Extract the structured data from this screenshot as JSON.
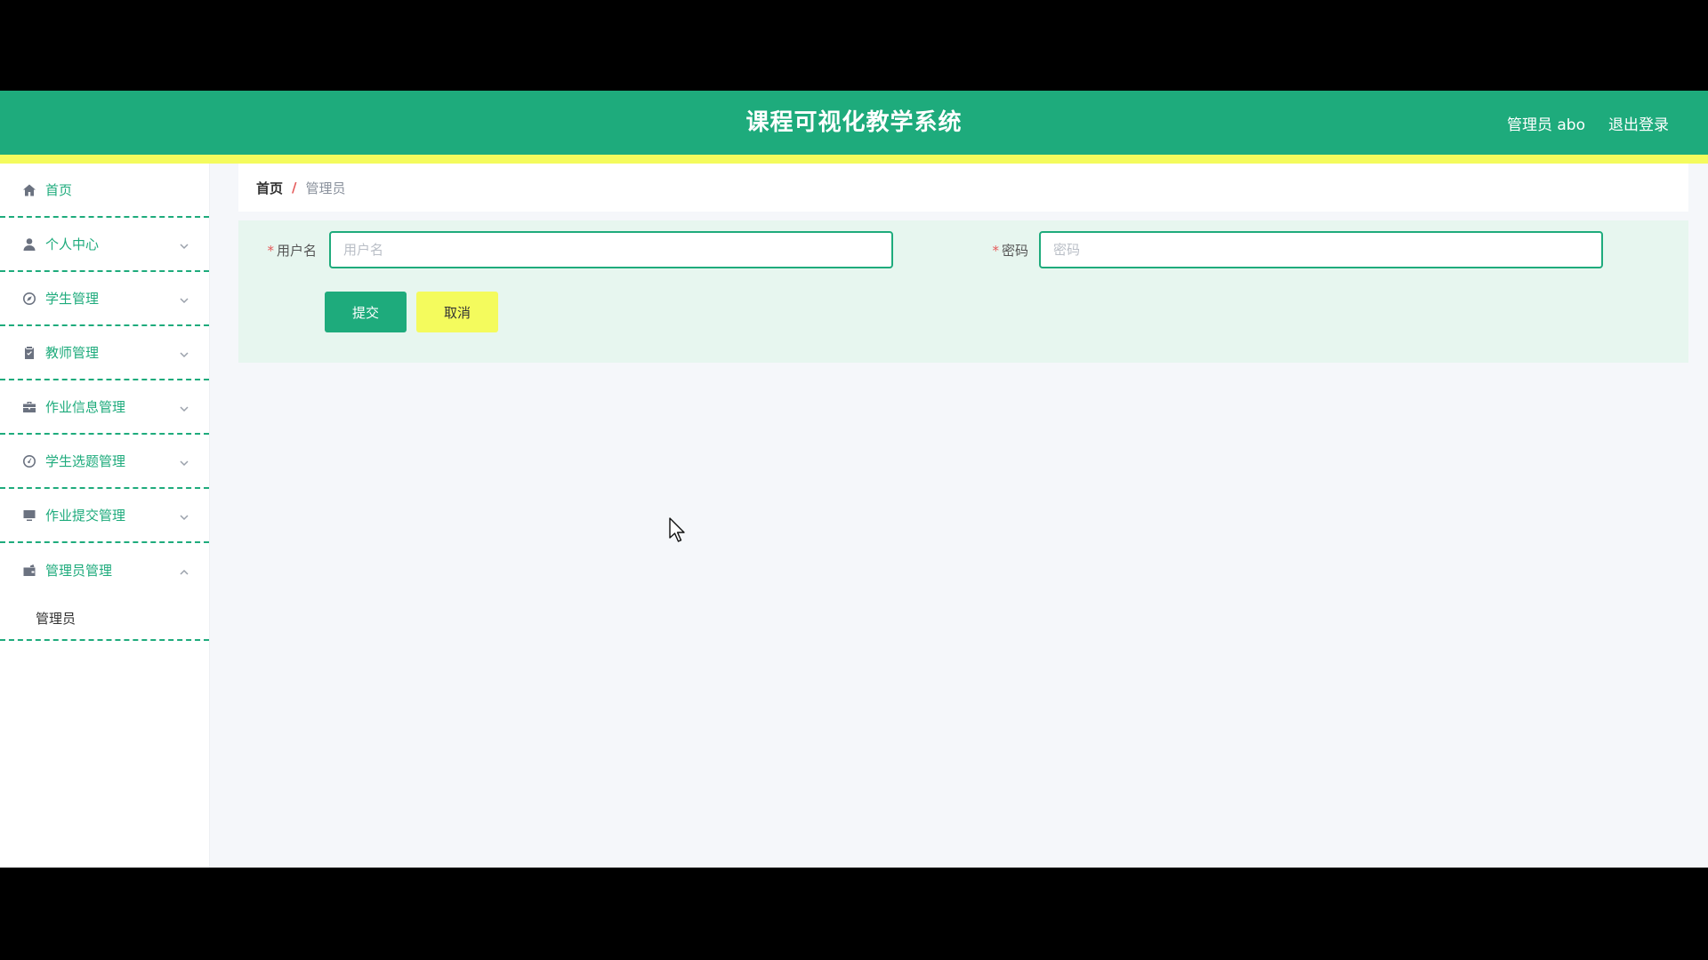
{
  "header": {
    "title": "课程可视化教学系统",
    "user": "管理员 abo",
    "logout": "退出登录",
    "colors": {
      "primary": "#1eab7c",
      "stripe": "#f4fb5d"
    }
  },
  "sidebar": {
    "items": [
      {
        "label": "首页",
        "icon": "home-icon",
        "has_arrow": false
      },
      {
        "label": "个人中心",
        "icon": "user-icon",
        "has_arrow": true
      },
      {
        "label": "学生管理",
        "icon": "compass-icon",
        "has_arrow": true
      },
      {
        "label": "教师管理",
        "icon": "clipboard-icon",
        "has_arrow": true
      },
      {
        "label": "作业信息管理",
        "icon": "briefcase-icon",
        "has_arrow": true
      },
      {
        "label": "学生选题管理",
        "icon": "gauge-icon",
        "has_arrow": true
      },
      {
        "label": "作业提交管理",
        "icon": "monitor-icon",
        "has_arrow": true
      },
      {
        "label": "管理员管理",
        "icon": "wallet-icon",
        "has_arrow": true,
        "expanded": true
      }
    ],
    "submenu": [
      {
        "label": "管理员"
      }
    ]
  },
  "breadcrumb": {
    "home": "首页",
    "separator": "/",
    "current": "管理员"
  },
  "form": {
    "username_label": "用户名",
    "username_placeholder": "用户名",
    "username_value": "",
    "password_label": "密码",
    "password_placeholder": "密码",
    "password_value": "",
    "required_mark": "*",
    "submit_label": "提交",
    "cancel_label": "取消"
  }
}
